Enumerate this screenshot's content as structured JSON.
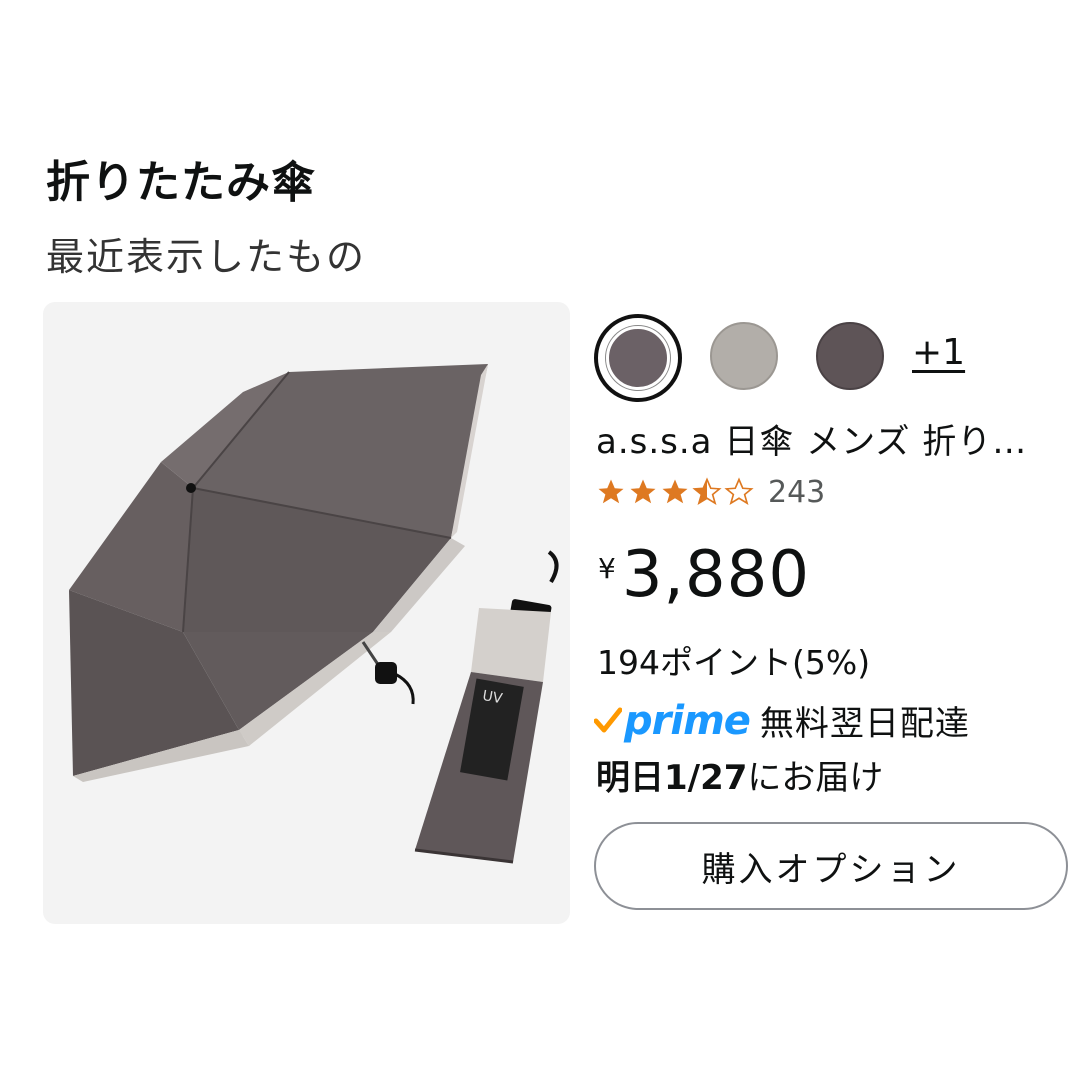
{
  "header": {
    "title": "折りたたみ傘",
    "subtitle": "最近表示したもの"
  },
  "product": {
    "image_alt": "a.s.s.a 日傘 メンズ 折りたたみ傘",
    "swatches": [
      {
        "color": "#6b6166",
        "selected": true
      },
      {
        "color": "#b2aea9",
        "selected": false
      },
      {
        "color": "#5e5457",
        "selected": false
      }
    ],
    "more_colors_label": "+1",
    "title": "a.s.s.a 日傘 メンズ 折り…",
    "rating": 3.5,
    "review_count": "243",
    "price_symbol": "¥",
    "price_value": "3,880",
    "points": "194ポイント(5%)",
    "prime_label": "prime",
    "delivery_text": "無料翌日配達",
    "delivery_date_bold": "明日1/27",
    "delivery_date_suffix": "にお届け",
    "buy_options_label": "購入オプション"
  },
  "colors": {
    "star": "#de7921",
    "prime_blue": "#1a98ff",
    "prime_check": "#ff9900"
  }
}
